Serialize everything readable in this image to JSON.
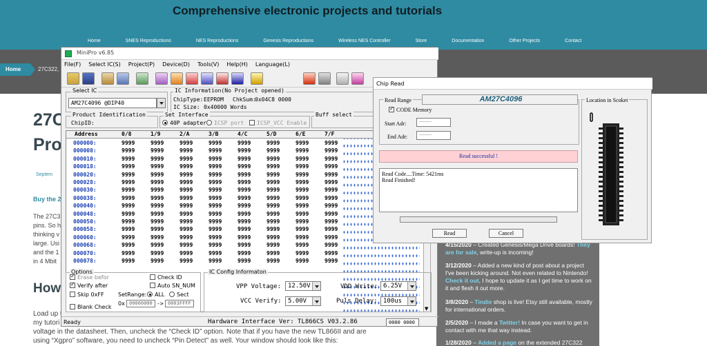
{
  "site": {
    "title": "Comprehensive electronic projects and tutorials",
    "nav": [
      "Home",
      "SNES Reproductions",
      "NES Reproductions",
      "Genesis Reproductions",
      "Wireless NES Controller",
      "Store",
      "Documentation",
      "Other Projects",
      "Contact"
    ],
    "breadcrumb_home": "Home",
    "breadcrumb_current": "27C322, 2",
    "h1_line1": "27C",
    "h1_line2": "Pro",
    "date_fragment": "Septem",
    "buy_fragment": "Buy the 2",
    "para_lines": [
      "The 27C3",
      "pins. So h",
      "thinking v",
      "large. Usi",
      "and the 1",
      "in 4 Mbit"
    ],
    "h2": "How",
    "body_line1": "Load up t",
    "body_line2": "my tutori",
    "body_line3": "voltage in the datasheet. Then, uncheck the “Check ID” option. Note that if you have the new TL866II and are",
    "body_line4": "using “Xgpro” software, you need to uncheck “Pin Detect” as well. Your window should look like this:",
    "news": [
      {
        "date": "4/15/2020",
        "text": " – Created Genesis/Mega Drive boards! ",
        "hl": "They are for sale",
        "tail": ", write-up is incoming!"
      },
      {
        "date": "3/12/2020",
        "text": " – Added a new kind of post about a project I've been kicking around. Not even related to Nintendo! ",
        "hl": "Check it out",
        "tail": ", I hope to update it as I get time to work on it and flesh it out more."
      },
      {
        "date": "3/8/2020",
        "text": " – ",
        "hl": "Tindie",
        "tail": " shop is live! Etsy still available, mostly for international orders."
      },
      {
        "date": "2/5/2020",
        "text": " – I made a ",
        "hl": "Twitter!",
        "tail": " In case you want to get in contact with me that way instead."
      },
      {
        "date": "1/28/2020",
        "text": " – ",
        "hl": "Added a page",
        "tail": " on the extended 27C322 and"
      }
    ]
  },
  "minipro": {
    "title": "MiniPro v6.85",
    "menu": [
      "File(F)",
      "Select IC(S)",
      "Project(P)",
      "Device(D)",
      "Tools(V)",
      "Help(H)",
      "Language(L)"
    ],
    "select_ic_label": "Select IC",
    "select_ic_value": "AM27C4096  @DIP40",
    "ic_info_label": "IC Information(No Project opened)",
    "chiptype_label": "ChipType:",
    "chiptype_value": "EEPROM",
    "chksum_label": "ChkSum:",
    "chksum_value": "0x04C8 0000",
    "icsize_label": "IC Size:",
    "icsize_value": "0x40000 Words",
    "product_id_label": "Product Identification",
    "chipid_label": "ChipID:",
    "set_interface_label": "Set Interface",
    "interface_40p": "40P adapter",
    "interface_icsp": "ICSP port",
    "icsp_vcc": "ICSP_VCC Enable",
    "buff_select": "Buff select",
    "hex_headers": [
      "Address",
      "0/8",
      "1/9",
      "2/A",
      "3/B",
      "4/C",
      "5/D",
      "6/E",
      "7/F"
    ],
    "hex_value": "9999",
    "hex_addresses": [
      "000000:",
      "000008:",
      "000010:",
      "000018:",
      "000020:",
      "000028:",
      "000030:",
      "000038:",
      "000040:",
      "000048:",
      "000050:",
      "000058:",
      "000060:",
      "000068:",
      "000070:",
      "000078:"
    ],
    "options_label": "Options",
    "erase_before": "Erase befor",
    "verify_after": "Verify after",
    "skip_0xff": "Skip 0xFF",
    "blank_check": "Blank Check",
    "check_id": "Check ID",
    "auto_sn": "Auto SN_NUM",
    "setrange_label": "SetRange:",
    "range_all": "ALL",
    "range_sect": "Sect",
    "range_0x": "0x",
    "range_from": "00000000",
    "range_arrow": "->",
    "range_to": "0003FFFF",
    "ic_config_label": "IC Config Informaton",
    "vpp_label": "VPP Voltage:",
    "vpp_value": "12.50V",
    "vdd_label": "VDD Write:",
    "vdd_value": "6.25V",
    "vcc_label": "VCC Verify:",
    "vcc_value": "5.00V",
    "puls_label": "Puls Delay:",
    "puls_value": "100us",
    "status_ready": "Ready",
    "hardware_ver": "Hardware Interface Ver: TL866CS V03.2.86",
    "status_count": "0000 0000"
  },
  "chip_read": {
    "title": "Chip Read",
    "read_range": "Read Range",
    "chip_name": "AM27C4096",
    "code_memory": "CODE Memory",
    "start_adr": "Start Adr:",
    "end_adr": "End Adr:",
    "adr_placeholder": "---------",
    "success": "Read successful !",
    "log_line1": "Read Code....Time: 5421ms",
    "log_line2": "Read Finished!",
    "read_button": "Read",
    "cancel_button": "Cancel",
    "location_label": "Location in Scoket"
  },
  "colors": {
    "accent": "#2e8ba2",
    "success_bg": "#ffd0d4",
    "success_text": "#1030a0",
    "addr": "#1a3fb5"
  }
}
